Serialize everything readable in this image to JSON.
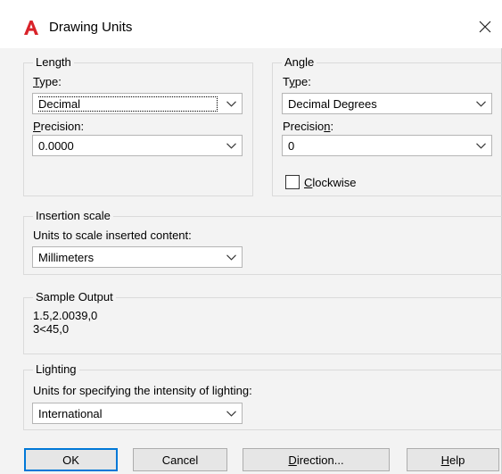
{
  "window": {
    "title": "Drawing Units",
    "app_icon": "autocad-a-icon",
    "close_icon": "close-icon"
  },
  "length": {
    "legend": "Length",
    "type_label_pre": "",
    "type_label_u": "T",
    "type_label_post": "ype:",
    "type_value": "Decimal",
    "precision_label_u": "P",
    "precision_label_post": "recision:",
    "precision_value": "0.0000"
  },
  "angle": {
    "legend": "Angle",
    "type_label_pre": "T",
    "type_label_u": "y",
    "type_label_post": "pe:",
    "type_value": "Decimal Degrees",
    "precision_label_pre": "Precisio",
    "precision_label_u": "n",
    "precision_label_post": ":",
    "precision_value": "0",
    "clockwise_u": "C",
    "clockwise_post": "lockwise",
    "clockwise_checked": false
  },
  "insertion": {
    "legend": "Insertion scale",
    "label": "Units to scale inserted content:",
    "value": "Millimeters"
  },
  "sample": {
    "legend": "Sample Output",
    "line1": "1.5,2.0039,0",
    "line2": "3<45,0"
  },
  "lighting": {
    "legend": "Lighting",
    "label": "Units for specifying the intensity of lighting:",
    "value": "International"
  },
  "buttons": {
    "ok": "OK",
    "cancel": "Cancel",
    "direction_u": "D",
    "direction_post": "irection...",
    "help_u": "H",
    "help_post": "elp"
  },
  "colors": {
    "accent": "#0078d7",
    "app_icon_red": "#d9232a"
  }
}
